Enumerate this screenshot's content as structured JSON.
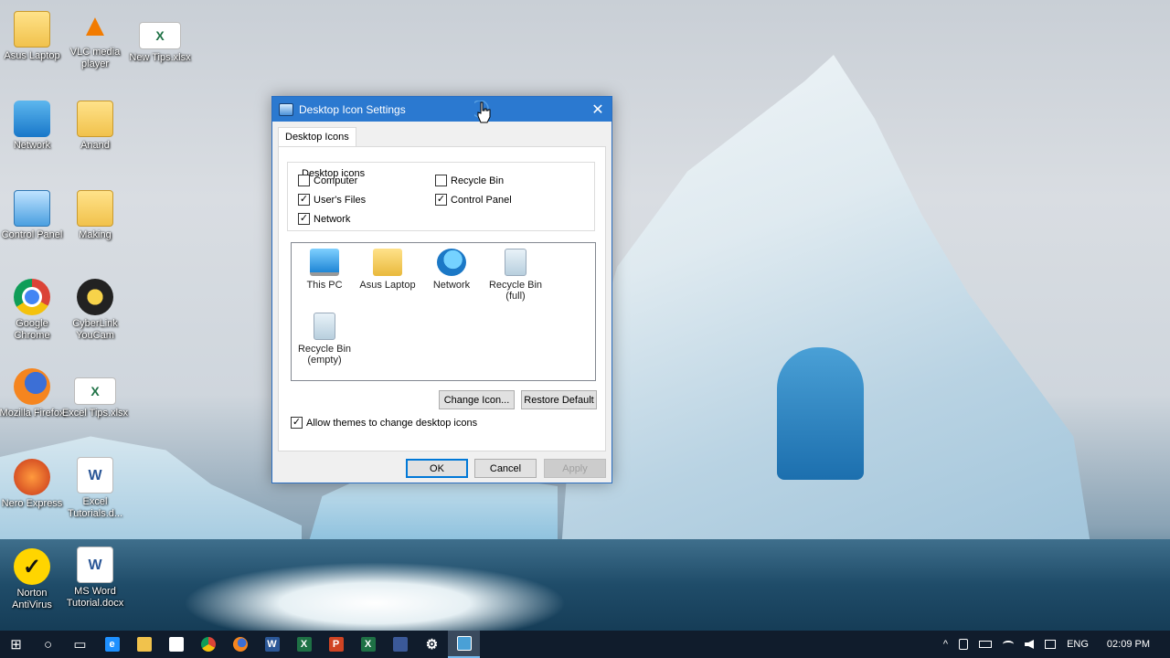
{
  "desktop": {
    "icons": [
      {
        "label": "Asus Laptop",
        "icon": "user-folder-icon"
      },
      {
        "label": "VLC media player",
        "icon": "vlc-icon"
      },
      {
        "label": "New Tips.xlsx",
        "icon": "excel-file-icon"
      },
      {
        "label": "Network",
        "icon": "network-icon"
      },
      {
        "label": "Anand",
        "icon": "folder-icon"
      },
      {
        "label": "Control Panel",
        "icon": "control-panel-icon"
      },
      {
        "label": "Making",
        "icon": "folder-icon"
      },
      {
        "label": "Google Chrome",
        "icon": "chrome-icon"
      },
      {
        "label": "CyberLink YouCam",
        "icon": "youcam-icon"
      },
      {
        "label": "Mozilla Firefox",
        "icon": "firefox-icon"
      },
      {
        "label": "Excel Tips.xlsx",
        "icon": "excel-file-icon"
      },
      {
        "label": "Nero Express",
        "icon": "nero-icon"
      },
      {
        "label": "Excel Tutorials.d...",
        "icon": "word-file-icon"
      },
      {
        "label": "Norton AntiVirus",
        "icon": "norton-icon"
      },
      {
        "label": "MS Word Tutorial.docx",
        "icon": "word-file-icon"
      }
    ],
    "glyphs": {
      "excel": "X",
      "word": "W",
      "norton": "✓",
      "vlc": "▲"
    }
  },
  "dialog": {
    "title": "Desktop Icon Settings",
    "close_glyph": "✕",
    "tab_label": "Desktop Icons",
    "group_label": "Desktop icons",
    "checkboxes": [
      {
        "label": "Computer",
        "checked": false,
        "mark": ""
      },
      {
        "label": "Recycle Bin",
        "checked": false,
        "mark": ""
      },
      {
        "label": "User's Files",
        "checked": true,
        "mark": "✓"
      },
      {
        "label": "Control Panel",
        "checked": true,
        "mark": "✓"
      },
      {
        "label": "Network",
        "checked": true,
        "mark": "✓"
      }
    ],
    "previews": [
      {
        "label": "This PC"
      },
      {
        "label": "Asus Laptop"
      },
      {
        "label": "Network"
      },
      {
        "label": "Recycle Bin (full)"
      },
      {
        "label": "Recycle Bin (empty)"
      }
    ],
    "change_icon": "Change Icon...",
    "restore_default": "Restore Default",
    "allow_themes": {
      "label": "Allow themes to change desktop icons",
      "checked": true,
      "mark": "✓"
    },
    "ok": "OK",
    "cancel": "Cancel",
    "apply": "Apply"
  },
  "taskbar": {
    "start_glyph": "⊞",
    "cortana_glyph": "○",
    "taskview_glyph": "▭",
    "apps": [
      {
        "name": "edge",
        "glyph": "e",
        "color": "#1e90ff"
      },
      {
        "name": "file-explorer",
        "glyph": "",
        "color": "#f1c24c"
      },
      {
        "name": "store",
        "glyph": "",
        "color": "#ffffff"
      },
      {
        "name": "chrome",
        "glyph": "",
        "color": "#db4437"
      },
      {
        "name": "firefox",
        "glyph": "",
        "color": "#f5851f"
      },
      {
        "name": "word",
        "glyph": "W",
        "color": "#2b5797"
      },
      {
        "name": "excel",
        "glyph": "X",
        "color": "#1e7145"
      },
      {
        "name": "powerpoint",
        "glyph": "P",
        "color": "#d04423"
      },
      {
        "name": "excel2",
        "glyph": "X",
        "color": "#1e7145"
      },
      {
        "name": "app-blue",
        "glyph": "",
        "color": "#3b5998"
      },
      {
        "name": "settings",
        "glyph": "⚙",
        "color": "transparent"
      },
      {
        "name": "display-settings",
        "glyph": "",
        "color": "#4aa0d6"
      }
    ],
    "tray": {
      "chevron": "^",
      "language": "ENG",
      "time": "02:09 PM"
    }
  }
}
